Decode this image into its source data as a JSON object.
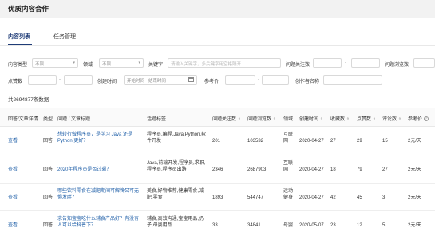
{
  "header": {
    "title": "优质内容合作"
  },
  "tabs": [
    {
      "label": "内容列表",
      "active": true
    },
    {
      "label": "任务管理",
      "active": false
    }
  ],
  "filters": {
    "content_type_label": "内容类型",
    "content_type_value": "不限",
    "domain_label": "领域",
    "domain_value": "不限",
    "keyword_label": "关键字",
    "keyword_placeholder": "请输入关键字，多关键字用空格隔开",
    "follow_label": "问题关注数",
    "views_label": "问题浏览数",
    "likes_label": "点赞数",
    "created_label": "创建时间",
    "date_range_placeholder": "开始时间 - 结束时间",
    "ref_price_label": "参考价",
    "author_label": "创作者名称",
    "range_dash": "-"
  },
  "summary": {
    "count_text": "共2694877条数据"
  },
  "table": {
    "headers": {
      "action": "回答/文章详情",
      "type": "类型",
      "title": "问题 / 文章标题",
      "tags": "话题标签",
      "follows": "问题关注数",
      "views": "问题浏览数",
      "domain": "领域",
      "created": "创建时间",
      "favorites": "收藏数",
      "likes": "点赞数",
      "comments": "评论数",
      "price": "参考价"
    },
    "rows": [
      {
        "action": "查看",
        "type": "回答",
        "title": "想转行做程序员，是学习 Java 还是 Python 更好？",
        "tags": "程序员,编程,Java,Python,软件开发",
        "follows": "201",
        "views": "103532",
        "domain": "互联网",
        "created": "2020-04-27",
        "favorites": "27",
        "likes": "29",
        "comments": "15",
        "price": "2元/天"
      },
      {
        "action": "查看",
        "type": "回答",
        "title": "2020年程序员是否过剩？",
        "tags": "Java,前端开发,程序员,求职,程序员,程序员出路",
        "follows": "2346",
        "views": "2687903",
        "domain": "互联网",
        "created": "2020-04-27",
        "favorites": "18",
        "likes": "79",
        "comments": "27",
        "price": "2元/天"
      },
      {
        "action": "查看",
        "type": "回答",
        "title": "哪些饮料零食在减肥期间可解馋又可无惧发胖？",
        "tags": "美食,好物推荐,健康零食,减肥,零食",
        "follows": "1893",
        "views": "544747",
        "domain": "运动健身",
        "created": "2020-04-27",
        "favorites": "42",
        "likes": "45",
        "comments": "3",
        "price": "2元/天"
      },
      {
        "action": "查看",
        "type": "回答",
        "title": "求告知宝宝吃什么辅食产品好？有没有人可以给科普下？",
        "tags": "辅食,高效沟通,宝宝用品,奶子,母婴用品",
        "follows": "33",
        "views": "34841",
        "domain": "母婴",
        "created": "2020-05-07",
        "favorites": "23",
        "likes": "12",
        "comments": "5",
        "price": "2元/天"
      }
    ]
  },
  "colors": {
    "accent": "#1f3c77",
    "link": "#1f5fa8",
    "header_bg": "#f2f2f2"
  }
}
